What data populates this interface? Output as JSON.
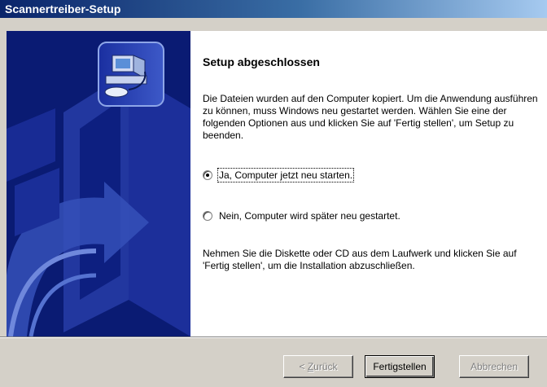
{
  "window": {
    "title": "Scannertreiber-Setup"
  },
  "content": {
    "heading": "Setup abgeschlossen",
    "description": "Die Dateien wurden auf den Computer kopiert. Um die Anwendung ausführen zu können, muss Windows neu gestartet werden. Wählen Sie eine der folgenden Optionen aus und klicken Sie auf 'Fertig stellen', um Setup zu beenden.",
    "options": [
      {
        "label": "Ja, Computer jetzt neu starten.",
        "selected": true
      },
      {
        "label": "Nein, Computer wird später neu gestartet.",
        "selected": false
      }
    ],
    "footer_note": "Nehmen Sie die Diskette oder CD aus dem Laufwerk und klicken Sie auf 'Fertig stellen', um die Installation abzuschließen."
  },
  "buttons": {
    "back_prefix": "< ",
    "back_hotkey": "Z",
    "back_rest": "urück",
    "finish": "Fertigstellen",
    "cancel": "Abbrechen"
  },
  "colors": {
    "titlebar_start": "#0a246a",
    "titlebar_end": "#a6caf0",
    "side_panel": "#0a1b73",
    "dialog_face": "#d4d0c8"
  }
}
